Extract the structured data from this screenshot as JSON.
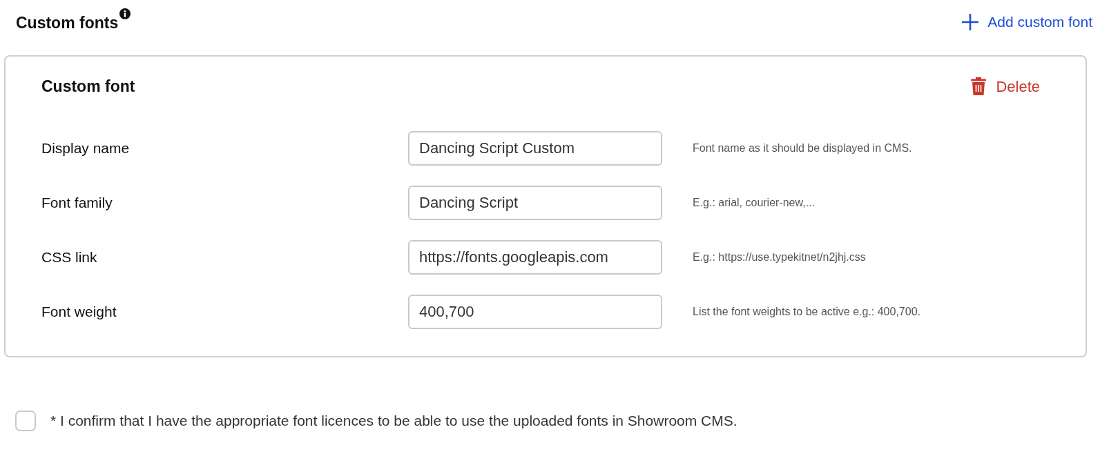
{
  "header": {
    "title": "Custom fonts",
    "add_button": "Add custom font"
  },
  "card": {
    "title": "Custom font",
    "delete_button": "Delete",
    "fields": [
      {
        "label": "Display name",
        "value": "Dancing Script Custom",
        "hint": "Font name as it should be displayed in CMS."
      },
      {
        "label": "Font family",
        "value": "Dancing Script",
        "hint": "E.g.: arial, courier-new,..."
      },
      {
        "label": "CSS link",
        "value": "https://fonts.googleapis.com",
        "hint": "E.g.: https://use.typekitnet/n2jhj.css"
      },
      {
        "label": "Font weight",
        "value": "400,700",
        "hint": "List the font weights to be active e.g.: 400,700."
      }
    ]
  },
  "confirm": {
    "label": "* I confirm that I have the appropriate font licences to be able to use the uploaded fonts in Showroom CMS.",
    "checked": false
  }
}
